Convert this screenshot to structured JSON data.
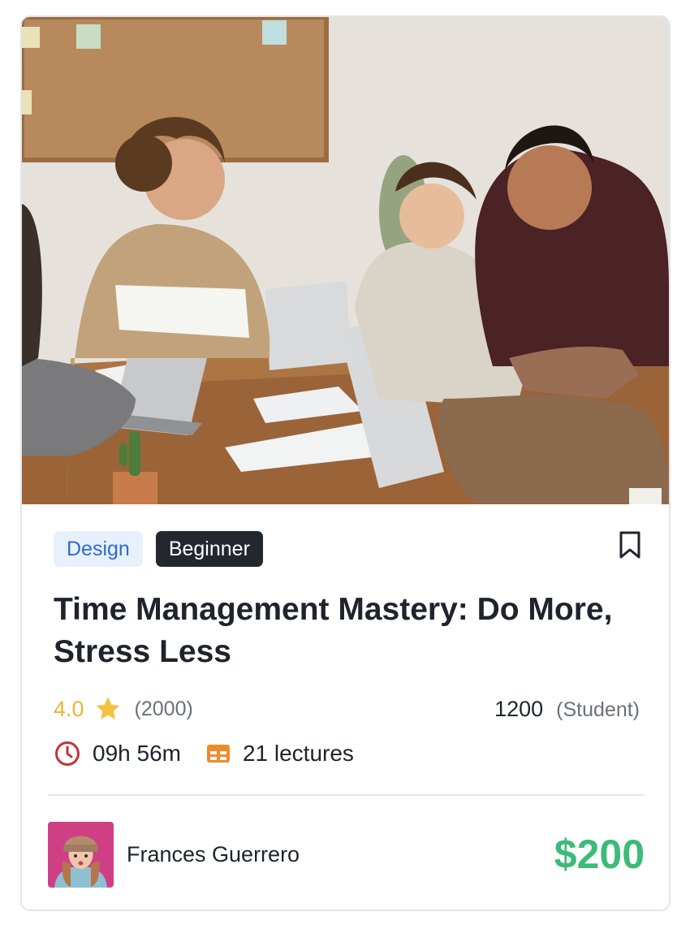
{
  "course": {
    "category": "Design",
    "level": "Beginner",
    "title": "Time Management Mastery: Do More, Stress Less",
    "rating": "4.0",
    "rating_count": "(2000)",
    "students": "1200",
    "students_label": "(Student)",
    "duration": "09h 56m",
    "lectures": "21 lectures",
    "instructor": "Frances Guerrero",
    "price": "$200"
  },
  "icons": {
    "bookmark": "bookmark-icon",
    "star": "star-icon",
    "clock": "clock-icon",
    "lectures": "table-icon"
  },
  "colors": {
    "rating": "#eab431",
    "price": "#3dbb78",
    "clock": "#c9303a",
    "lectures": "#ef8a2c",
    "category_bg": "#e8f1fb",
    "category_text": "#2f6ad0",
    "level_bg": "#23272f"
  }
}
